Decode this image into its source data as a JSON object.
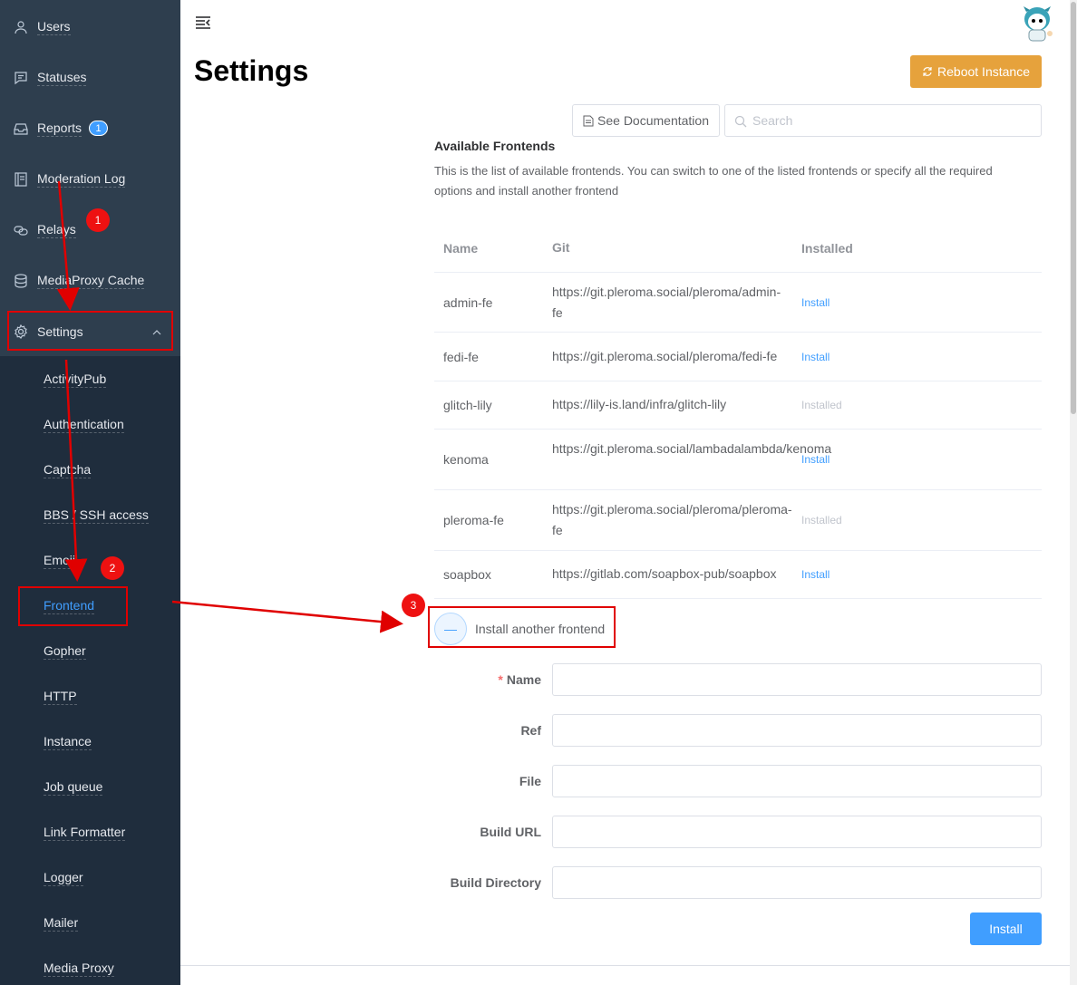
{
  "sidebar": {
    "items": [
      {
        "label": "Users",
        "icon": "user-icon"
      },
      {
        "label": "Statuses",
        "icon": "chat-icon"
      },
      {
        "label": "Reports",
        "icon": "inbox-icon",
        "badge": "1"
      },
      {
        "label": "Moderation Log",
        "icon": "notebook-icon"
      },
      {
        "label": "Relays",
        "icon": "connection-icon"
      },
      {
        "label": "MediaProxy Cache",
        "icon": "database-icon"
      },
      {
        "label": "Settings",
        "icon": "gear-icon",
        "expanded": true
      }
    ],
    "settings_submenu": [
      "ActivityPub",
      "Authentication",
      "Captcha",
      "BBS / SSH access",
      "Emoji",
      "Frontend",
      "Gopher",
      "HTTP",
      "Instance",
      "Job queue",
      "Link Formatter",
      "Logger",
      "Mailer",
      "Media Proxy"
    ],
    "active_submenu": "Frontend"
  },
  "header": {
    "title": "Settings",
    "reboot_label": "Reboot Instance",
    "doc_label": "See Documentation",
    "search_placeholder": "Search"
  },
  "frontends": {
    "title": "Available Frontends",
    "description": "This is the list of available frontends. You can switch to one of the listed frontends or specify all the required options and install another frontend",
    "columns": [
      "Name",
      "Git",
      "Installed"
    ],
    "rows": [
      {
        "name": "admin-fe",
        "git": "https://git.pleroma.social/pleroma/admin-fe",
        "status": "Install"
      },
      {
        "name": "fedi-fe",
        "git": "https://git.pleroma.social/pleroma/fedi-fe",
        "status": "Install"
      },
      {
        "name": "glitch-lily",
        "git": "https://lily-is.land/infra/glitch-lily",
        "status": "Installed"
      },
      {
        "name": "kenoma",
        "git": "https://git.pleroma.social/lambadalambda/kenoma",
        "status": "Install"
      },
      {
        "name": "pleroma-fe",
        "git": "https://git.pleroma.social/pleroma/pleroma-fe",
        "status": "Installed"
      },
      {
        "name": "soapbox",
        "git": "https://gitlab.com/soapbox-pub/soapbox",
        "status": "Install"
      }
    ]
  },
  "install_form": {
    "toggle_label": "Install another frontend",
    "toggle_symbol": "—",
    "fields": [
      {
        "label": "Name",
        "required": true,
        "value": ""
      },
      {
        "label": "Ref",
        "required": false,
        "value": ""
      },
      {
        "label": "File",
        "required": false,
        "value": ""
      },
      {
        "label": "Build URL",
        "required": false,
        "value": ""
      },
      {
        "label": "Build Directory",
        "required": false,
        "value": ""
      }
    ],
    "required_mark": "*",
    "submit_label": "Install"
  },
  "annotations": [
    "1",
    "2",
    "3"
  ],
  "colors": {
    "sidebar_bg": "#2e3e4e",
    "submenu_bg": "#1f2d3d",
    "accent": "#409eff",
    "warning": "#e6a23c",
    "annotation_red": "#e00000"
  }
}
